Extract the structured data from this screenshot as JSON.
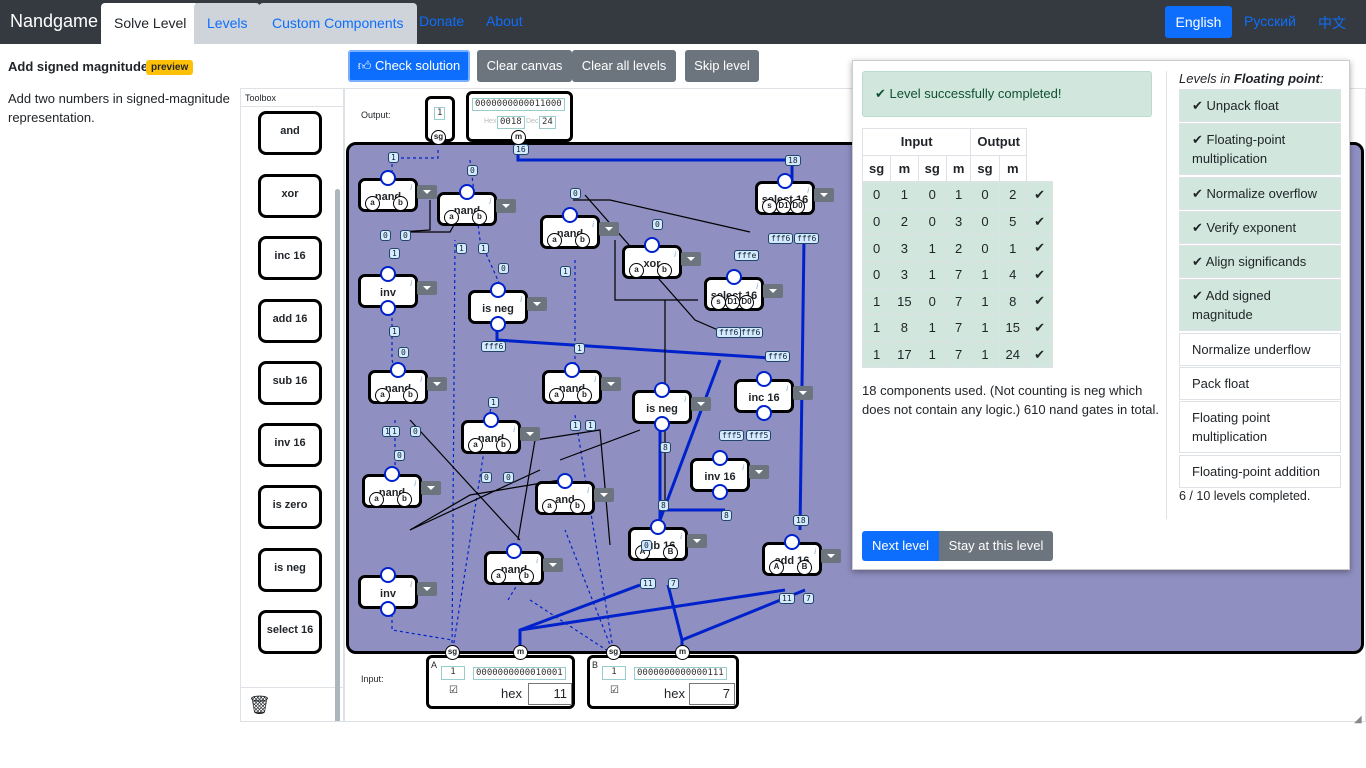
{
  "navbar": {
    "brand": "Nandgame",
    "tabs": [
      "Solve Level",
      "Levels",
      "Custom Components"
    ],
    "links": [
      "Donate",
      "About"
    ],
    "languages": [
      "English",
      "Русский",
      "中文"
    ]
  },
  "level": {
    "title": "Add signed magnitude",
    "badge": "preview",
    "description": "Add two numbers in signed-magnitude representation."
  },
  "toolbar": {
    "check": "Check solution",
    "clear_canvas": "Clear canvas",
    "clear_all": "Clear all levels",
    "skip": "Skip level"
  },
  "toolbox": {
    "title": "Toolbox",
    "items": [
      "and",
      "xor",
      "inc 16",
      "add 16",
      "sub 16",
      "inv 16",
      "is zero",
      "is neg",
      "select 16"
    ]
  },
  "canvas": {
    "output_label": "Output:",
    "input_label": "Input:",
    "output": {
      "sg": "1",
      "bits": "0000000000011000",
      "hex_prefix": "Hex",
      "hex": "0018",
      "dec_prefix": "Dec",
      "dec": "24",
      "pins": [
        "sg",
        "m"
      ]
    },
    "input_a": {
      "name": "A",
      "sg": "1",
      "bits": "0000000000010001",
      "check": "☑",
      "hex_label": "hex",
      "hex": "11",
      "pins": [
        "sg",
        "m"
      ]
    },
    "input_b": {
      "name": "B",
      "sg": "1",
      "bits": "0000000000000111",
      "check": "☑",
      "hex_label": "hex",
      "hex": "7",
      "pins": [
        "sg",
        "m"
      ]
    },
    "components": [
      {
        "label": "nand",
        "inputs": [
          "a",
          "b"
        ]
      },
      {
        "label": "nand",
        "inputs": [
          "a",
          "b"
        ]
      },
      {
        "label": "nand",
        "inputs": [
          "a",
          "b"
        ]
      },
      {
        "label": "xor",
        "inputs": [
          "a",
          "b"
        ]
      },
      {
        "label": "select 16",
        "inputs": [
          "s",
          "D1",
          "D0"
        ]
      },
      {
        "label": "inv",
        "inputs": []
      },
      {
        "label": "is neg",
        "inputs": []
      },
      {
        "label": "select 16",
        "inputs": [
          "s",
          "D1",
          "D0"
        ]
      },
      {
        "label": "nand",
        "inputs": [
          "a",
          "b"
        ]
      },
      {
        "label": "nand",
        "inputs": [
          "a",
          "b"
        ]
      },
      {
        "label": "is neg",
        "inputs": []
      },
      {
        "label": "inc 16",
        "inputs": []
      },
      {
        "label": "nand",
        "inputs": [
          "a",
          "b"
        ]
      },
      {
        "label": "inv 16",
        "inputs": []
      },
      {
        "label": "nand",
        "inputs": [
          "a",
          "b"
        ]
      },
      {
        "label": "and",
        "inputs": [
          "a",
          "b"
        ]
      },
      {
        "label": "sub 16",
        "inputs": [
          "A",
          "B"
        ]
      },
      {
        "label": "add 16",
        "inputs": [
          "A",
          "B"
        ]
      },
      {
        "label": "inv",
        "inputs": []
      },
      {
        "label": "nand",
        "inputs": [
          "a",
          "b"
        ]
      }
    ],
    "wire_values": [
      "1",
      "0",
      "0",
      "0",
      "0",
      "0",
      "1",
      "1",
      "1",
      "0",
      "1",
      "0",
      "1",
      "1",
      "1",
      "1",
      "1",
      "0",
      "0",
      "0",
      "0",
      "8",
      "8",
      "8",
      "0",
      "1",
      "1",
      "7",
      "11",
      "11",
      "7",
      "18",
      "18",
      "16",
      "fff6",
      "fff6",
      "fff6",
      "fff6",
      "fff6",
      "fff6",
      "fff6",
      "fff5",
      "fff5",
      "fffe"
    ]
  },
  "result": {
    "success": "Level successfully completed!",
    "headers": {
      "input": "Input",
      "output": "Output",
      "cols": [
        "sg",
        "m",
        "sg",
        "m",
        "sg",
        "m"
      ]
    },
    "rows": [
      [
        "0",
        "1",
        "0",
        "1",
        "0",
        "2",
        "✔"
      ],
      [
        "0",
        "2",
        "0",
        "3",
        "0",
        "5",
        "✔"
      ],
      [
        "0",
        "3",
        "1",
        "2",
        "0",
        "1",
        "✔"
      ],
      [
        "0",
        "3",
        "1",
        "7",
        "1",
        "4",
        "✔"
      ],
      [
        "1",
        "15",
        "0",
        "7",
        "1",
        "8",
        "✔"
      ],
      [
        "1",
        "8",
        "1",
        "7",
        "1",
        "15",
        "✔"
      ],
      [
        "1",
        "17",
        "1",
        "7",
        "1",
        "24",
        "✔"
      ]
    ],
    "summary": "18 components used. (Not counting is neg which does not contain any logic.) 610 nand gates in total.",
    "next": "Next level",
    "stay": "Stay at this level"
  },
  "levels_panel": {
    "title_prefix": "Levels in ",
    "title_category": "Floating point",
    "title_suffix": ":",
    "items": [
      {
        "label": "Unpack float",
        "done": true
      },
      {
        "label": "Floating-point multiplication",
        "done": true
      },
      {
        "label": "Normalize overflow",
        "done": true
      },
      {
        "label": "Verify exponent",
        "done": true
      },
      {
        "label": "Align significands",
        "done": true
      },
      {
        "label": "Add signed magnitude",
        "done": true
      },
      {
        "label": "Normalize underflow",
        "done": false
      },
      {
        "label": "Pack float",
        "done": false
      },
      {
        "label": "Floating point multiplication",
        "done": false
      },
      {
        "label": "Floating-point addition",
        "done": false
      }
    ],
    "progress": "6 / 10 levels completed."
  },
  "colors": {
    "navbar": "#343a40",
    "primary": "#0d6efd",
    "secondary": "#6c757d",
    "board": "#8f8fc1",
    "success_bg": "#d1e7dd",
    "wire": "#0022cc"
  }
}
